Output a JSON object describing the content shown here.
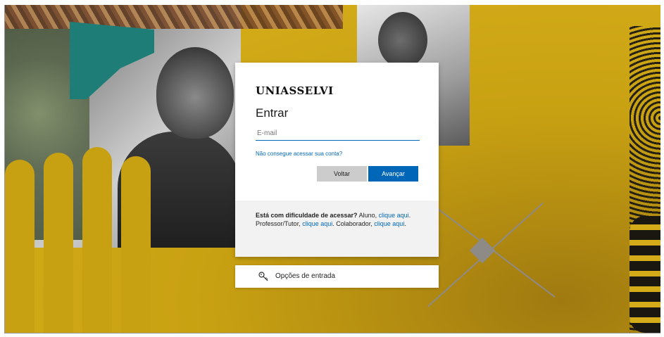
{
  "brand": {
    "logo_text": "UNIASSELVI"
  },
  "login": {
    "title": "Entrar",
    "email_placeholder": "E-mail",
    "forgot_link": "Não consegue acessar sua conta?",
    "back_button": "Voltar",
    "next_button": "Avançar"
  },
  "help": {
    "bold": "Está com dificuldade de acessar?",
    "text1": " Aluno, ",
    "link1": "clique aqui",
    "text2": ". Professor/Tutor, ",
    "link2": "clique aqui",
    "text3": ". Colaborador, ",
    "link3": "clique aqui",
    "text4": "."
  },
  "signin_options": {
    "label": "Opções de entrada",
    "icon": "key-icon"
  },
  "colors": {
    "background_gold": "#c8a112",
    "primary_blue": "#0067b8",
    "secondary_button": "#cccccc"
  }
}
